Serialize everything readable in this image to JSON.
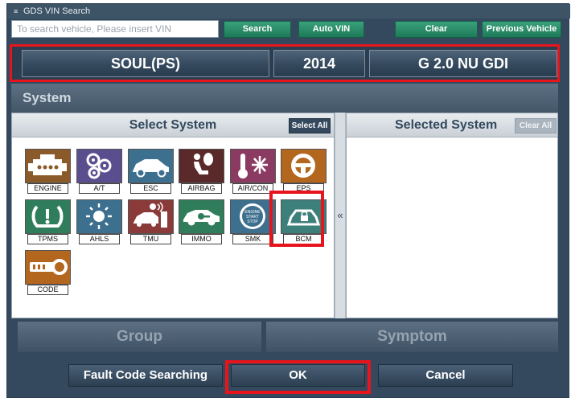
{
  "window": {
    "title": "GDS VIN Search"
  },
  "toolbar": {
    "vin_placeholder": "To search vehicle, Please insert VIN",
    "search_label": "Search",
    "auto_vin_label": "Auto VIN",
    "clear_label": "Clear",
    "previous_vehicle_label": "Previous Vehicle"
  },
  "vehicle": {
    "model": "SOUL(PS)",
    "year": "2014",
    "engine": "G 2.0 NU GDI"
  },
  "system": {
    "header": "System",
    "select_title": "Select System",
    "select_all_label": "Select All",
    "selected_title": "Selected System",
    "clear_all_label": "Clear All",
    "move_arrow": "«",
    "tiles": [
      {
        "label": "ENGINE",
        "icon": "engine-icon",
        "color": "#8b5a2b"
      },
      {
        "label": "A/T",
        "icon": "gears-icon",
        "color": "#5b4e8f"
      },
      {
        "label": "ESC",
        "icon": "car-side-icon",
        "color": "#3d6f8e"
      },
      {
        "label": "AIRBAG",
        "icon": "airbag-icon",
        "color": "#5a2a2a"
      },
      {
        "label": "AIR/CON",
        "icon": "aircon-icon",
        "color": "#8b3a62"
      },
      {
        "label": "EPS",
        "icon": "steering-wheel-icon",
        "color": "#b3661e"
      },
      {
        "label": "TPMS",
        "icon": "tire-pressure-icon",
        "color": "#2f7d5a"
      },
      {
        "label": "AHLS",
        "icon": "headlight-icon",
        "color": "#3d6f8e"
      },
      {
        "label": "TMU",
        "icon": "telematics-icon",
        "color": "#8b3a3a"
      },
      {
        "label": "IMMO",
        "icon": "immobilizer-icon",
        "color": "#2f7d5a"
      },
      {
        "label": "SMK",
        "icon": "engine-start-stop-icon",
        "color": "#3d6f8e"
      },
      {
        "label": "BCM",
        "icon": "body-control-icon",
        "color": "#3d7f7a"
      },
      {
        "label": "CODE",
        "icon": "key-code-icon",
        "color": "#b3661e"
      }
    ]
  },
  "tabs": {
    "group_label": "Group",
    "symptom_label": "Symptom"
  },
  "actions": {
    "fault_code_label": "Fault Code Searching",
    "ok_label": "OK",
    "cancel_label": "Cancel"
  }
}
